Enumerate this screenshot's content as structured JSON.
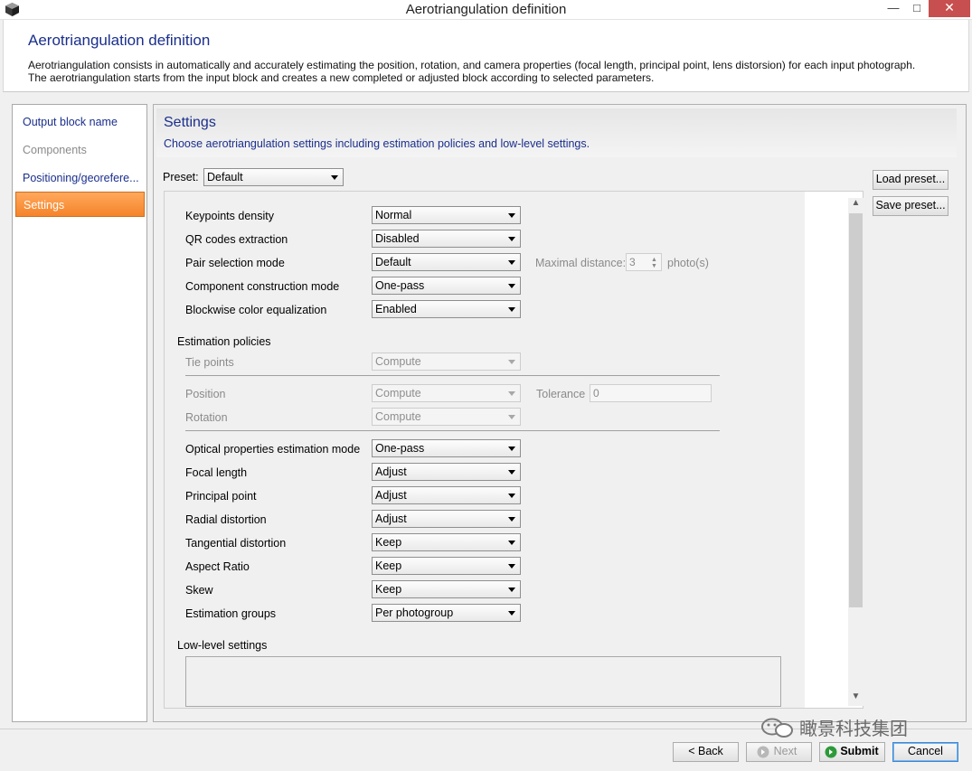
{
  "window": {
    "title": "Aerotriangulation definition",
    "minimize": "—",
    "maximize": "□",
    "close": "✕"
  },
  "header": {
    "title": "Aerotriangulation definition",
    "description_line1": "Aerotriangulation consists in automatically and accurately estimating the position, rotation, and camera properties (focal length, principal point, lens distorsion) for each input photograph.",
    "description_line2": "The aerotriangulation starts from the input block and creates a new completed or adjusted block according to selected parameters."
  },
  "nav": {
    "items": [
      {
        "label": "Output block name",
        "state": "normal"
      },
      {
        "label": "Components",
        "state": "disabled"
      },
      {
        "label": "Positioning/georefere...",
        "state": "normal"
      },
      {
        "label": "Settings",
        "state": "active"
      }
    ]
  },
  "settings": {
    "title": "Settings",
    "subtitle": "Choose aerotriangulation settings including estimation policies and low-level settings.",
    "preset_label": "Preset:",
    "preset_value": "Default",
    "load_preset": "Load preset...",
    "save_preset": "Save preset...",
    "rows": [
      {
        "label": "Keypoints density",
        "value": "Normal"
      },
      {
        "label": "QR codes extraction",
        "value": "Disabled"
      },
      {
        "label": "Pair selection mode",
        "value": "Default"
      },
      {
        "label": "Component construction mode",
        "value": "One-pass"
      },
      {
        "label": "Blockwise color equalization",
        "value": "Enabled"
      }
    ],
    "maximal_distance_label": "Maximal distance:",
    "maximal_distance_value": "3",
    "maximal_distance_unit": "photo(s)",
    "estimation_policies_label": "Estimation policies",
    "tie_points": {
      "label": "Tie points",
      "value": "Compute"
    },
    "position": {
      "label": "Position",
      "value": "Compute"
    },
    "tolerance_label": "Tolerance",
    "tolerance_value": "0",
    "rotation": {
      "label": "Rotation",
      "value": "Compute"
    },
    "optical_rows": [
      {
        "label": "Optical properties estimation mode",
        "value": "One-pass"
      },
      {
        "label": "Focal length",
        "value": "Adjust"
      },
      {
        "label": "Principal point",
        "value": "Adjust"
      },
      {
        "label": "Radial distortion",
        "value": "Adjust"
      },
      {
        "label": "Tangential distortion",
        "value": "Keep"
      },
      {
        "label": "Aspect Ratio",
        "value": "Keep"
      },
      {
        "label": "Skew",
        "value": "Keep"
      },
      {
        "label": "Estimation groups",
        "value": "Per photogroup"
      }
    ],
    "low_level_label": "Low-level settings"
  },
  "footer": {
    "back": "< Back",
    "next": "Next",
    "submit": "Submit",
    "cancel": "Cancel",
    "watermark": "瞰景科技集团"
  },
  "colors": {
    "accent_blue": "#1a2f8c",
    "active_orange": "#f58329",
    "close_red": "#c74f4f"
  }
}
